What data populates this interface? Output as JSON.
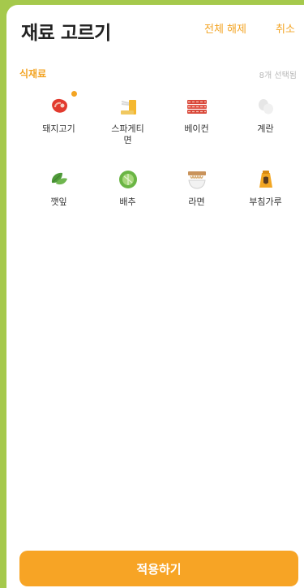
{
  "header": {
    "title": "재료 고르기",
    "clear_all": "전체 해제",
    "cancel": "취소"
  },
  "section": {
    "title": "식재료",
    "count": "8개 선택됨"
  },
  "ingredients": [
    {
      "label": "돼지고기",
      "icon": "pork-meat-icon",
      "badge": true
    },
    {
      "label": "스파게티 면",
      "icon": "spaghetti-icon",
      "badge": false
    },
    {
      "label": "베이컨",
      "icon": "bacon-icon",
      "badge": false
    },
    {
      "label": "계란",
      "icon": "egg-icon",
      "badge": false
    },
    {
      "label": "깻잎",
      "icon": "perilla-leaf-icon",
      "badge": false
    },
    {
      "label": "배추",
      "icon": "cabbage-icon",
      "badge": false
    },
    {
      "label": "라면",
      "icon": "ramen-icon",
      "badge": false
    },
    {
      "label": "부침가루",
      "icon": "flour-bag-icon",
      "badge": false
    }
  ],
  "apply_button": "적용하기",
  "colors": {
    "accent": "#f3a423",
    "background": "#a5c94c",
    "button": "#f7a425"
  }
}
